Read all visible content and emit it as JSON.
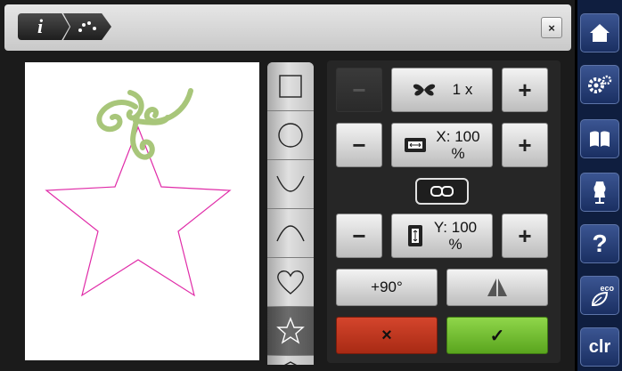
{
  "header": {
    "info_label": "i",
    "close_label": "×"
  },
  "shape_list": [
    {
      "name": "square",
      "active": false
    },
    {
      "name": "circle",
      "active": false
    },
    {
      "name": "arc-down",
      "active": false
    },
    {
      "name": "arc-up",
      "active": false
    },
    {
      "name": "heart",
      "active": false
    },
    {
      "name": "star",
      "active": true
    }
  ],
  "controls": {
    "minus": "−",
    "plus": "+",
    "repeat_value": "1 x",
    "x_scale_line1": "X: 100",
    "x_scale_line2": "%",
    "y_scale_line1": "Y: 100",
    "y_scale_line2": "%",
    "rotate_label": "+90°",
    "cancel_label": "×",
    "confirm_label": "✓"
  },
  "sidebar": {
    "items": [
      "home-icon",
      "settings-icon",
      "book-icon",
      "dress-form-icon",
      "help-icon",
      "eco-icon",
      "clr"
    ],
    "help_label": "?",
    "eco_label": "eco",
    "clr_label": "clr"
  },
  "colors": {
    "sidebar_bg": "#0f1e3f",
    "cancel_red": "#c0301c",
    "confirm_green": "#6fc02a",
    "star_outline": "#e02ca8",
    "embroidery_green": "#9ec070"
  }
}
